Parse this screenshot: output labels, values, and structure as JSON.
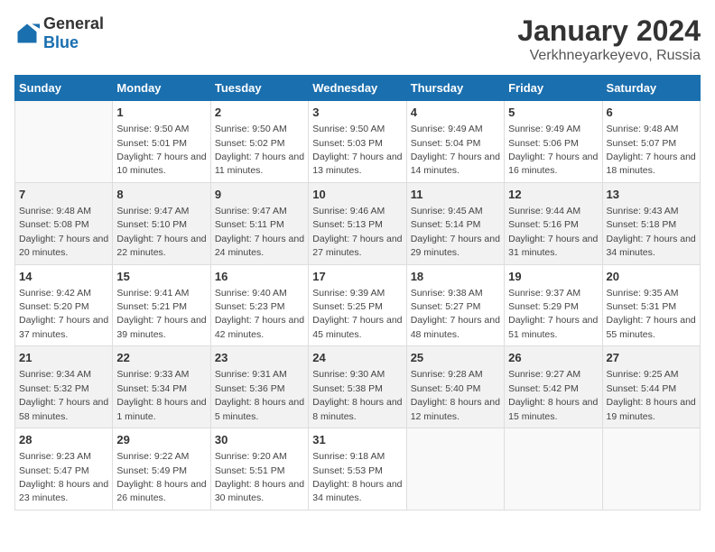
{
  "logo": {
    "general": "General",
    "blue": "Blue"
  },
  "title": "January 2024",
  "subtitle": "Verkhneyarkeyevo, Russia",
  "days_of_week": [
    "Sunday",
    "Monday",
    "Tuesday",
    "Wednesday",
    "Thursday",
    "Friday",
    "Saturday"
  ],
  "weeks": [
    [
      {
        "day": "",
        "sunrise": "",
        "sunset": "",
        "daylight": ""
      },
      {
        "day": "1",
        "sunrise": "Sunrise: 9:50 AM",
        "sunset": "Sunset: 5:01 PM",
        "daylight": "Daylight: 7 hours and 10 minutes."
      },
      {
        "day": "2",
        "sunrise": "Sunrise: 9:50 AM",
        "sunset": "Sunset: 5:02 PM",
        "daylight": "Daylight: 7 hours and 11 minutes."
      },
      {
        "day": "3",
        "sunrise": "Sunrise: 9:50 AM",
        "sunset": "Sunset: 5:03 PM",
        "daylight": "Daylight: 7 hours and 13 minutes."
      },
      {
        "day": "4",
        "sunrise": "Sunrise: 9:49 AM",
        "sunset": "Sunset: 5:04 PM",
        "daylight": "Daylight: 7 hours and 14 minutes."
      },
      {
        "day": "5",
        "sunrise": "Sunrise: 9:49 AM",
        "sunset": "Sunset: 5:06 PM",
        "daylight": "Daylight: 7 hours and 16 minutes."
      },
      {
        "day": "6",
        "sunrise": "Sunrise: 9:48 AM",
        "sunset": "Sunset: 5:07 PM",
        "daylight": "Daylight: 7 hours and 18 minutes."
      }
    ],
    [
      {
        "day": "7",
        "sunrise": "Sunrise: 9:48 AM",
        "sunset": "Sunset: 5:08 PM",
        "daylight": "Daylight: 7 hours and 20 minutes."
      },
      {
        "day": "8",
        "sunrise": "Sunrise: 9:47 AM",
        "sunset": "Sunset: 5:10 PM",
        "daylight": "Daylight: 7 hours and 22 minutes."
      },
      {
        "day": "9",
        "sunrise": "Sunrise: 9:47 AM",
        "sunset": "Sunset: 5:11 PM",
        "daylight": "Daylight: 7 hours and 24 minutes."
      },
      {
        "day": "10",
        "sunrise": "Sunrise: 9:46 AM",
        "sunset": "Sunset: 5:13 PM",
        "daylight": "Daylight: 7 hours and 27 minutes."
      },
      {
        "day": "11",
        "sunrise": "Sunrise: 9:45 AM",
        "sunset": "Sunset: 5:14 PM",
        "daylight": "Daylight: 7 hours and 29 minutes."
      },
      {
        "day": "12",
        "sunrise": "Sunrise: 9:44 AM",
        "sunset": "Sunset: 5:16 PM",
        "daylight": "Daylight: 7 hours and 31 minutes."
      },
      {
        "day": "13",
        "sunrise": "Sunrise: 9:43 AM",
        "sunset": "Sunset: 5:18 PM",
        "daylight": "Daylight: 7 hours and 34 minutes."
      }
    ],
    [
      {
        "day": "14",
        "sunrise": "Sunrise: 9:42 AM",
        "sunset": "Sunset: 5:20 PM",
        "daylight": "Daylight: 7 hours and 37 minutes."
      },
      {
        "day": "15",
        "sunrise": "Sunrise: 9:41 AM",
        "sunset": "Sunset: 5:21 PM",
        "daylight": "Daylight: 7 hours and 39 minutes."
      },
      {
        "day": "16",
        "sunrise": "Sunrise: 9:40 AM",
        "sunset": "Sunset: 5:23 PM",
        "daylight": "Daylight: 7 hours and 42 minutes."
      },
      {
        "day": "17",
        "sunrise": "Sunrise: 9:39 AM",
        "sunset": "Sunset: 5:25 PM",
        "daylight": "Daylight: 7 hours and 45 minutes."
      },
      {
        "day": "18",
        "sunrise": "Sunrise: 9:38 AM",
        "sunset": "Sunset: 5:27 PM",
        "daylight": "Daylight: 7 hours and 48 minutes."
      },
      {
        "day": "19",
        "sunrise": "Sunrise: 9:37 AM",
        "sunset": "Sunset: 5:29 PM",
        "daylight": "Daylight: 7 hours and 51 minutes."
      },
      {
        "day": "20",
        "sunrise": "Sunrise: 9:35 AM",
        "sunset": "Sunset: 5:31 PM",
        "daylight": "Daylight: 7 hours and 55 minutes."
      }
    ],
    [
      {
        "day": "21",
        "sunrise": "Sunrise: 9:34 AM",
        "sunset": "Sunset: 5:32 PM",
        "daylight": "Daylight: 7 hours and 58 minutes."
      },
      {
        "day": "22",
        "sunrise": "Sunrise: 9:33 AM",
        "sunset": "Sunset: 5:34 PM",
        "daylight": "Daylight: 8 hours and 1 minute."
      },
      {
        "day": "23",
        "sunrise": "Sunrise: 9:31 AM",
        "sunset": "Sunset: 5:36 PM",
        "daylight": "Daylight: 8 hours and 5 minutes."
      },
      {
        "day": "24",
        "sunrise": "Sunrise: 9:30 AM",
        "sunset": "Sunset: 5:38 PM",
        "daylight": "Daylight: 8 hours and 8 minutes."
      },
      {
        "day": "25",
        "sunrise": "Sunrise: 9:28 AM",
        "sunset": "Sunset: 5:40 PM",
        "daylight": "Daylight: 8 hours and 12 minutes."
      },
      {
        "day": "26",
        "sunrise": "Sunrise: 9:27 AM",
        "sunset": "Sunset: 5:42 PM",
        "daylight": "Daylight: 8 hours and 15 minutes."
      },
      {
        "day": "27",
        "sunrise": "Sunrise: 9:25 AM",
        "sunset": "Sunset: 5:44 PM",
        "daylight": "Daylight: 8 hours and 19 minutes."
      }
    ],
    [
      {
        "day": "28",
        "sunrise": "Sunrise: 9:23 AM",
        "sunset": "Sunset: 5:47 PM",
        "daylight": "Daylight: 8 hours and 23 minutes."
      },
      {
        "day": "29",
        "sunrise": "Sunrise: 9:22 AM",
        "sunset": "Sunset: 5:49 PM",
        "daylight": "Daylight: 8 hours and 26 minutes."
      },
      {
        "day": "30",
        "sunrise": "Sunrise: 9:20 AM",
        "sunset": "Sunset: 5:51 PM",
        "daylight": "Daylight: 8 hours and 30 minutes."
      },
      {
        "day": "31",
        "sunrise": "Sunrise: 9:18 AM",
        "sunset": "Sunset: 5:53 PM",
        "daylight": "Daylight: 8 hours and 34 minutes."
      },
      {
        "day": "",
        "sunrise": "",
        "sunset": "",
        "daylight": ""
      },
      {
        "day": "",
        "sunrise": "",
        "sunset": "",
        "daylight": ""
      },
      {
        "day": "",
        "sunrise": "",
        "sunset": "",
        "daylight": ""
      }
    ]
  ]
}
